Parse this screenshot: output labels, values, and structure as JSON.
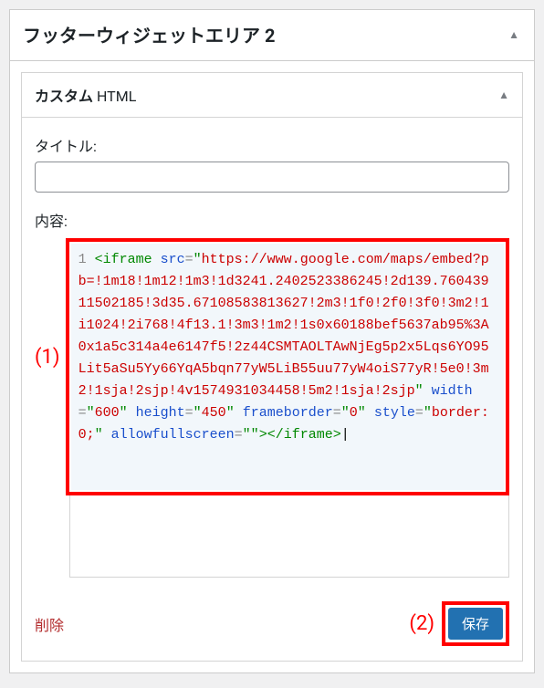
{
  "outer": {
    "title": "フッターウィジェットエリア 2"
  },
  "widget": {
    "title_bold": "カスタム",
    "title_rest": " HTML",
    "labels": {
      "title": "タイトル:",
      "content": "内容:"
    },
    "fields": {
      "title_value": "",
      "content_value": "<iframe src=\"https://www.google.com/maps/embed?pb=!1m18!1m12!1m3!1d3241.2402523386245!2d139.76043911502185!3d35.67108583813627!2m3!1f0!2f0!3f0!3m2!1i1024!2i768!4f13.1!3m3!1m2!1s0x60188bef5637ab95%3A0x1a5c314a4e6147f5!2z44CSMTAOLTAwNjEg5p2x5Lqs6YO95Lit5aSu5Yy66YqA5bqn77yW5LiB55uu77yW4oiS77yR!5e0!3m2!1sja!2sjp!4v1574931034458!5m2!1sja!2sjp\" width=\"600\" height=\"450\" frameborder=\"0\" style=\"border:0;\" allowfullscreen=\"\"></iframe>"
    },
    "code_tokens": {
      "line_num": "1",
      "tag_open": "<",
      "iframe": "iframe",
      "src_attr": " src",
      "eq": "=",
      "q": "\"",
      "url_part1": "https://www.google.com",
      "url_part2": "/maps/embed?pb=!1m18!1m12!1m3!1d3241.2402523386245!2d139.76043911502185!3d35.67108583813627!2m3!1f0!2f0!3f0!3m2!1i1024!2i768!4f13.1!3m3!1m2!1s0x60188bef5637ab95%3A0x1a5c314a4e6147f5!2z44CSMTAOLTAwNjEg5p2x5Lqs6YO95Lit5aSu5Yy66YqA5bqn77yW5LiB55uu77yW4oiS77yR!5e0!3m2!1sja!2sjp!4v1574931034458!5m2!1sja!2sjp",
      "width_attr": " width",
      "width_val": "600",
      "height_attr": " height",
      "height_val": "450",
      "frameborder_attr": "frameborder",
      "frameborder_val": "0",
      "style_attr": " style",
      "style_val": "border:0;",
      "allowfs_attr": "allowfullscreen",
      "tag_close": ">",
      "close_open": "</",
      "iframe2": "iframe",
      "close_close": ">"
    },
    "actions": {
      "delete": "削除",
      "save": "保存"
    }
  },
  "annotations": {
    "one": "(1)",
    "two": "(2)"
  },
  "colors": {
    "accent": "#2271b1",
    "danger": "#b32d2e",
    "highlight": "#ff0000"
  }
}
